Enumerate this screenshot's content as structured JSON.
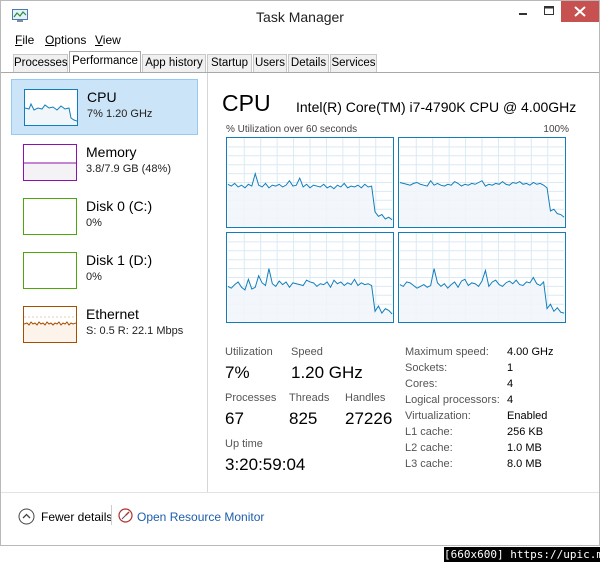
{
  "window": {
    "title": "Task Manager"
  },
  "menu": [
    {
      "label": "File",
      "mnemonic": "F",
      "rest": "ile"
    },
    {
      "label": "Options",
      "mnemonic": "O",
      "rest": "ptions"
    },
    {
      "label": "View",
      "mnemonic": "V",
      "rest": "iew"
    }
  ],
  "tabs": [
    {
      "label": "Processes",
      "active": false
    },
    {
      "label": "Performance",
      "active": true
    },
    {
      "label": "App history",
      "active": false
    },
    {
      "label": "Startup",
      "active": false
    },
    {
      "label": "Users",
      "active": false
    },
    {
      "label": "Details",
      "active": false
    },
    {
      "label": "Services",
      "active": false
    }
  ],
  "sidebar": [
    {
      "name": "CPU",
      "detail": "7% 1.20 GHz",
      "color": "#117dbb",
      "selected": true,
      "icon": "cpu-thumbnail-graph"
    },
    {
      "name": "Memory",
      "detail": "3.8/7.9 GB (48%)",
      "color": "#8b12ae",
      "selected": false,
      "icon": "memory-thumbnail-graph"
    },
    {
      "name": "Disk 0 (C:)",
      "detail": "0%",
      "color": "#4da60c",
      "selected": false,
      "icon": "disk0-thumbnail-graph"
    },
    {
      "name": "Disk 1 (D:)",
      "detail": "0%",
      "color": "#4da60c",
      "selected": false,
      "icon": "disk1-thumbnail-graph"
    },
    {
      "name": "Ethernet",
      "detail": "S: 0.5  R: 22.1 Mbps",
      "color": "#a74f01",
      "selected": false,
      "icon": "ethernet-thumbnail-graph"
    }
  ],
  "main": {
    "title": "CPU",
    "model": "Intel(R) Core(TM) i7-4790K CPU @ 4.00GHz",
    "util_label": "% Utilization over 60 seconds",
    "util_max": "100%",
    "graph_color": "#117dbb",
    "graph_fill": "#f1f6fa",
    "stats": {
      "utilization_label": "Utilization",
      "utilization": "7%",
      "speed_label": "Speed",
      "speed": "1.20 GHz",
      "processes_label": "Processes",
      "processes": "67",
      "threads_label": "Threads",
      "threads": "825",
      "handles_label": "Handles",
      "handles": "27226",
      "uptime_label": "Up time",
      "uptime": "3:20:59:04"
    },
    "specs": [
      {
        "label": "Maximum speed:",
        "value": "4.00 GHz"
      },
      {
        "label": "Sockets:",
        "value": "1"
      },
      {
        "label": "Cores:",
        "value": "4"
      },
      {
        "label": "Logical processors:",
        "value": "4"
      },
      {
        "label": "Virtualization:",
        "value": "Enabled"
      },
      {
        "label": "L1 cache:",
        "value": "256 KB"
      },
      {
        "label": "L2 cache:",
        "value": "1.0 MB"
      },
      {
        "label": "L3 cache:",
        "value": "8.0 MB"
      }
    ]
  },
  "chart_data": {
    "type": "line",
    "ylim": [
      0,
      100
    ],
    "series": [
      {
        "values": [
          48,
          46,
          49,
          45,
          47,
          44,
          48,
          46,
          60,
          47,
          45,
          49,
          44,
          47,
          46,
          48,
          45,
          47,
          52,
          46,
          47,
          55,
          45,
          48,
          44,
          47,
          46,
          45,
          48,
          44,
          46,
          43,
          47,
          45,
          49,
          44,
          46,
          45,
          47,
          44,
          48,
          45,
          46,
          17,
          12,
          14,
          9,
          11,
          8
        ]
      },
      {
        "values": [
          50,
          49,
          48,
          47,
          49,
          50,
          48,
          47,
          46,
          52,
          47,
          49,
          47,
          46,
          48,
          47,
          51,
          49,
          46,
          48,
          47,
          49,
          48,
          50,
          52,
          46,
          48,
          47,
          49,
          48,
          51,
          48,
          47,
          50,
          49,
          51,
          48,
          49,
          47,
          50,
          48,
          49,
          47,
          44,
          18,
          20,
          15,
          14,
          11
        ]
      },
      {
        "values": [
          40,
          38,
          42,
          45,
          39,
          36,
          48,
          37,
          39,
          52,
          44,
          41,
          60,
          43,
          40,
          46,
          42,
          45,
          39,
          44,
          43,
          42,
          41,
          47,
          45,
          44,
          40,
          43,
          42,
          45,
          39,
          47,
          43,
          45,
          41,
          44,
          42,
          48,
          41,
          44,
          42,
          43,
          41,
          12,
          18,
          10,
          15,
          13,
          9
        ]
      },
      {
        "values": [
          42,
          40,
          45,
          44,
          41,
          38,
          40,
          42,
          39,
          41,
          60,
          44,
          40,
          43,
          38,
          42,
          45,
          39,
          46,
          48,
          41,
          44,
          43,
          40,
          46,
          58,
          40,
          45,
          47,
          42,
          40,
          44,
          46,
          43,
          47,
          42,
          41,
          45,
          44,
          50,
          43,
          41,
          45,
          15,
          20,
          12,
          16,
          11,
          10
        ]
      }
    ]
  },
  "footer": {
    "fewer_details": "Fewer details",
    "fewer_mnemonic": "d",
    "open_resource_monitor": "Open Resource Monitor"
  },
  "watermark": "[660x600] https://upic.me/"
}
